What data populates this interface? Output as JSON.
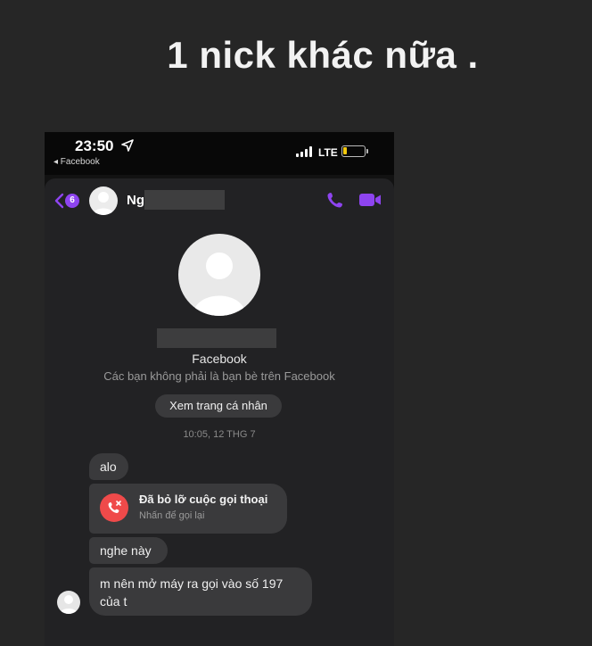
{
  "story": {
    "caption": "1 nick khác nữa ."
  },
  "status_bar": {
    "time": "23:50",
    "back_app": "◂ Facebook",
    "network": "LTE",
    "icons": [
      "location-arrow-icon",
      "signal-bars-icon",
      "battery-icon"
    ]
  },
  "header": {
    "unread_count": "6",
    "contact_name": "Ng",
    "icons": [
      "back-chevron-icon",
      "phone-call-icon",
      "video-call-icon"
    ],
    "accent_color": "#8e44f0"
  },
  "profile": {
    "platform": "Facebook",
    "relationship": "Các bạn không phải là bạn bè trên Facebook",
    "view_profile_label": "Xem trang cá nhân"
  },
  "conversation": {
    "timestamp": "10:05, 12 THG 7",
    "messages": [
      {
        "type": "text",
        "text": "alo"
      },
      {
        "type": "missed_call",
        "title": "Đã bỏ lỡ cuộc gọi thoại",
        "subtitle": "Nhấn để gọi lại"
      },
      {
        "type": "text",
        "text": "nghe này"
      },
      {
        "type": "text",
        "line1": "m nên mở máy ra gọi vào số 197",
        "line2": "của t"
      }
    ]
  }
}
